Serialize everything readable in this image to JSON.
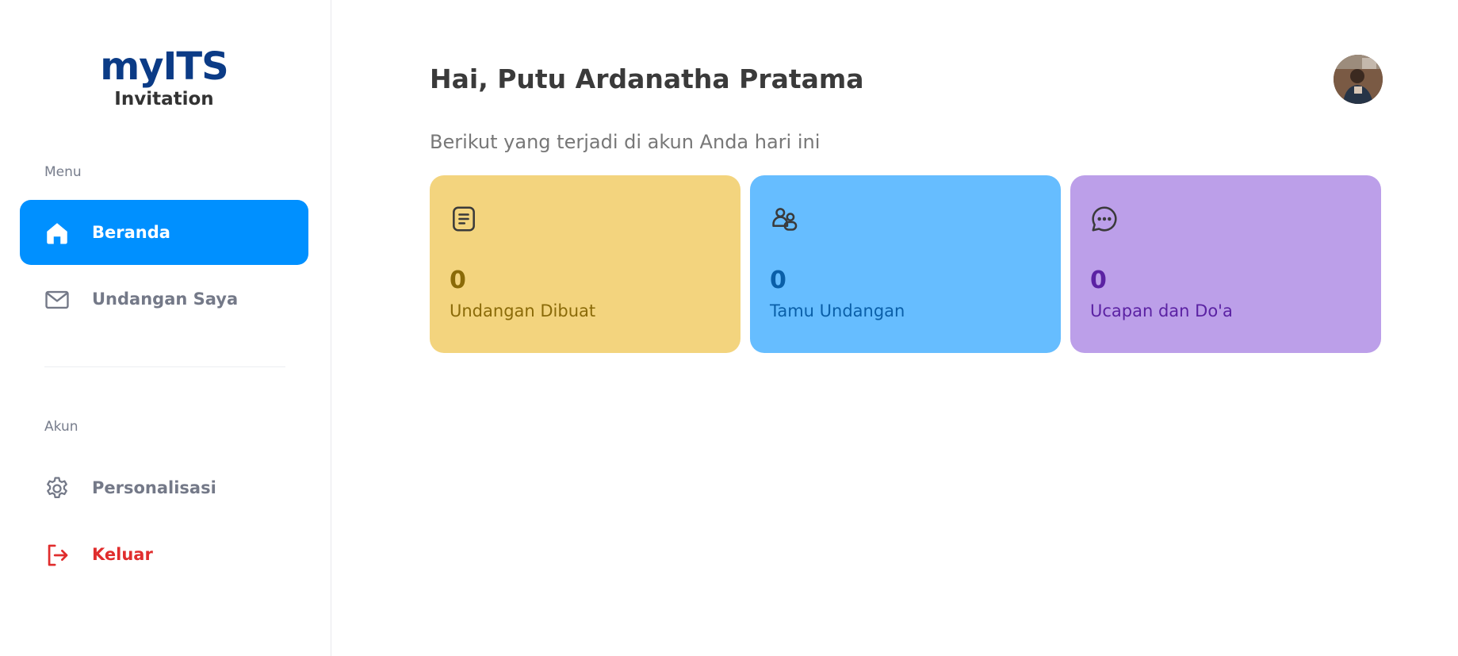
{
  "app": {
    "logo_text": "myITS",
    "logo_subtitle": "Invitation",
    "brand_color": "#0b3b86"
  },
  "sidebar": {
    "sections": [
      {
        "label": "Menu",
        "items": [
          {
            "label": "Beranda",
            "icon": "home-icon",
            "active": true
          },
          {
            "label": "Undangan Saya",
            "icon": "mail-icon",
            "active": false
          }
        ]
      },
      {
        "label": "Akun",
        "items": [
          {
            "label": "Personalisasi",
            "icon": "gear-icon",
            "active": false
          },
          {
            "label": "Keluar",
            "icon": "logout-icon",
            "active": false,
            "danger": true
          }
        ]
      }
    ],
    "active_color": "#0090ff",
    "danger_color": "#e02d2d"
  },
  "header": {
    "greeting": "Hai, Putu Ardanatha Pratama",
    "subtitle": "Berikut yang terjadi di akun Anda hari ini",
    "avatar_icon": "user-avatar"
  },
  "stats": [
    {
      "value": "0",
      "label": "Undangan Dibuat",
      "icon": "document-icon",
      "bg": "#f3d47e",
      "fg": "#8a6a08"
    },
    {
      "value": "0",
      "label": "Tamu Undangan",
      "icon": "users-icon",
      "bg": "#66bdff",
      "fg": "#0a5fa8"
    },
    {
      "value": "0",
      "label": "Ucapan dan Do'a",
      "icon": "chat-icon",
      "bg": "#bc9fe9",
      "fg": "#5b22a3"
    }
  ]
}
